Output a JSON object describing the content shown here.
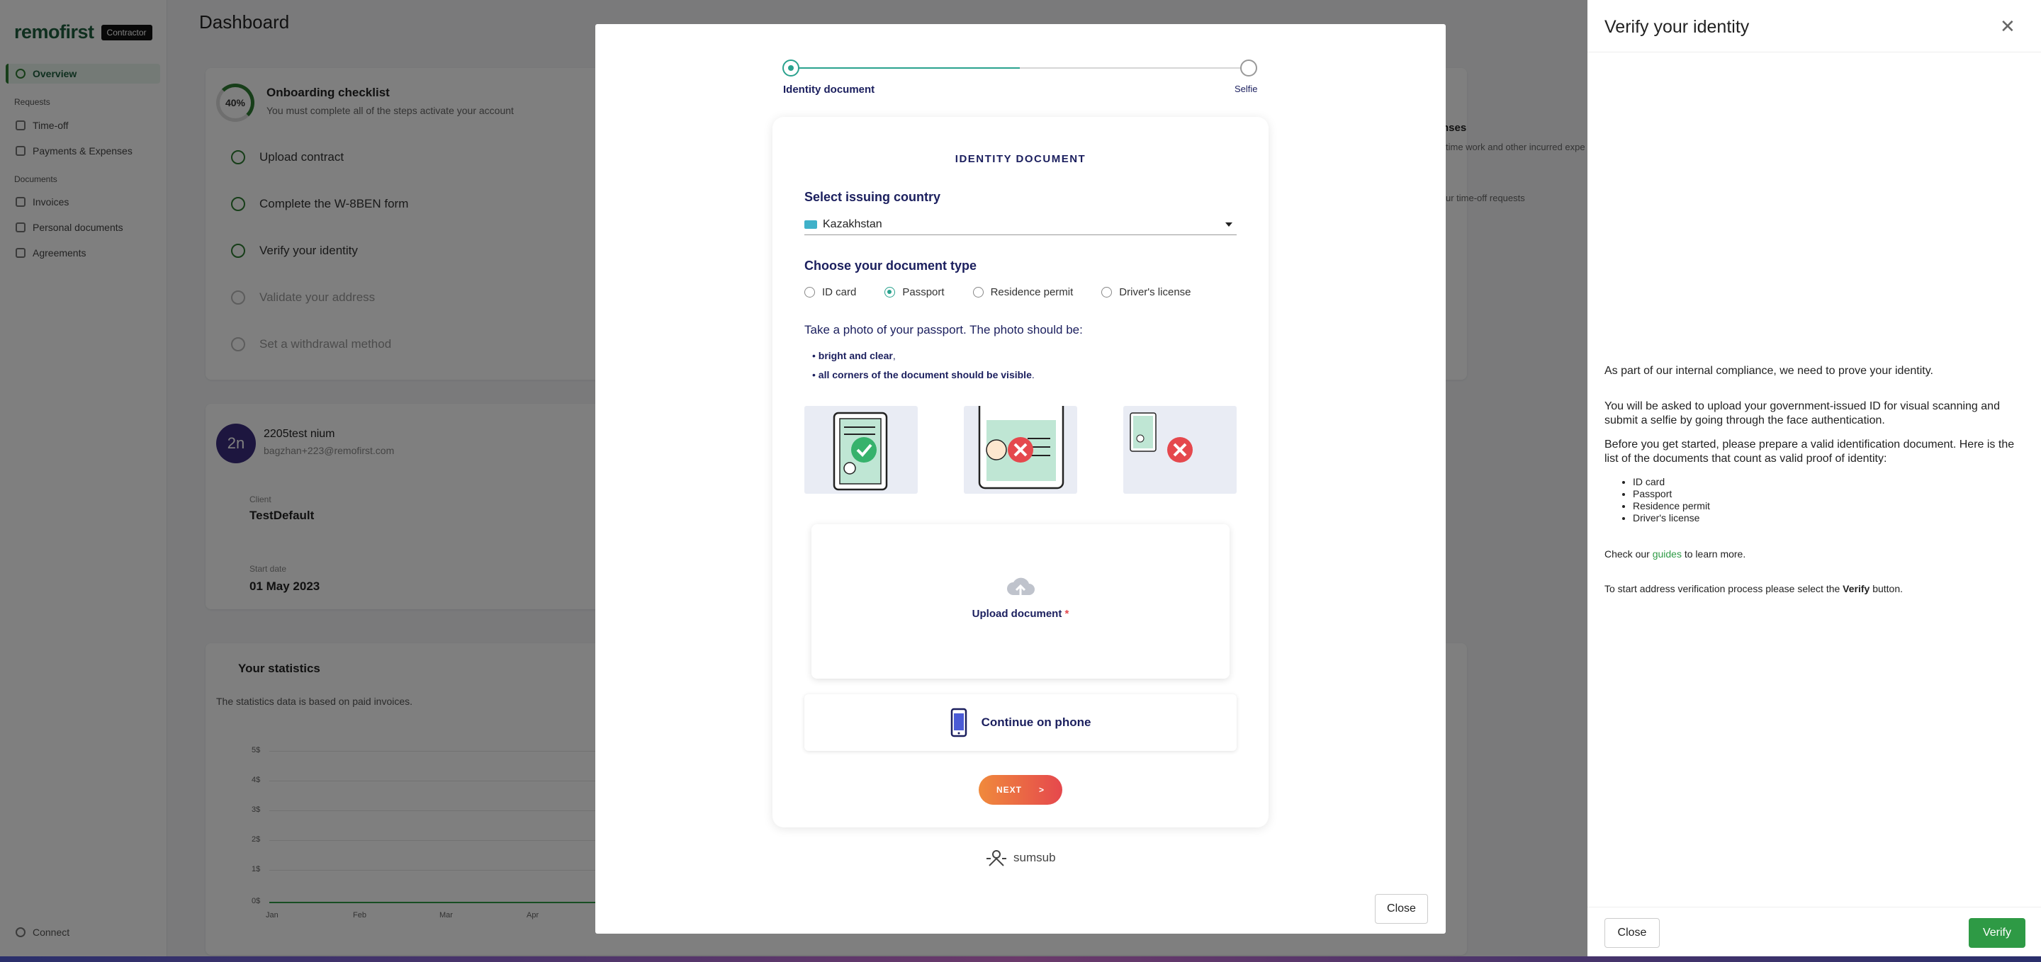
{
  "sidebar": {
    "logo": "remofirst",
    "badge": "Contractor",
    "items": [
      {
        "label": "Overview",
        "section": ""
      },
      {
        "label": "Time-off",
        "section": "Requests"
      },
      {
        "label": "Payments & Expenses",
        "section": ""
      },
      {
        "label": "Invoices",
        "section": "Documents"
      },
      {
        "label": "Personal documents",
        "section": ""
      },
      {
        "label": "Agreements",
        "section": ""
      }
    ],
    "sections": [
      "Requests",
      "Documents"
    ],
    "connect": "Connect"
  },
  "dashboard": {
    "title": "Dashboard",
    "onboarding": {
      "percent": "40%",
      "title": "Onboarding checklist",
      "subtitle": "You must complete all of the steps activate your account",
      "items": [
        "Upload contract",
        "Complete the W-8BEN form",
        "Verify your identity",
        "Validate your address",
        "Set a withdrawal method"
      ]
    },
    "user": {
      "initials": "2n",
      "name": "2205test nium",
      "email": "bagzhan+223@remofirst.com",
      "client_label": "Client",
      "client_value": "TestDefault",
      "start_label": "Start date",
      "start_value": "01 May 2023"
    },
    "stats": {
      "title": "Your statistics",
      "subtitle": "The statistics data is based on paid invoices.",
      "yticks": [
        "5$",
        "4$",
        "3$",
        "2$",
        "1$",
        "0$"
      ],
      "xticks": [
        "Jan",
        "Feb",
        "Mar",
        "Apr"
      ]
    },
    "right_card": {
      "title": "nses",
      "line1": "time work and other incurred expe",
      "line2": "ur time-off requests"
    }
  },
  "modal": {
    "steps": [
      "Identity document",
      "Selfie"
    ],
    "heading": "IDENTITY DOCUMENT",
    "country_label": "Select issuing country",
    "country_value": "Kazakhstan",
    "doc_type_label": "Choose your document type",
    "doc_types": [
      "ID card",
      "Passport",
      "Residence permit",
      "Driver's license"
    ],
    "selected_doc_type": "Passport",
    "photo_instruction": "Take a photo of your passport. The photo should be:",
    "bullets": [
      {
        "bold": "bright and clear",
        "rest": ","
      },
      {
        "bold": "all corners of the document should be visible",
        "rest": "."
      }
    ],
    "upload_label": "Upload document",
    "upload_required": "*",
    "phone_label": "Continue on phone",
    "next_label": "NEXT",
    "next_arrow": ">",
    "brand": "sumsub",
    "close": "Close"
  },
  "drawer": {
    "title": "Verify your identity",
    "p1": "As part of our internal compliance, we need to prove your identity.",
    "p2": "You will be asked to upload your government-issued ID for visual scanning and submit a selfie by going through the face authentication.",
    "p3": "Before you get started, please prepare a valid identification document. Here is the list of the documents that count as valid proof of identity:",
    "list": [
      "ID card",
      "Passport",
      "Residence permit",
      "Driver's license"
    ],
    "check_prefix": "Check our ",
    "check_link": "guides",
    "check_suffix": " to learn more.",
    "start_prefix": "To start address verification process please select the ",
    "start_bold": "Verify",
    "start_suffix": " button.",
    "close": "Close",
    "verify": "Verify"
  },
  "colors": {
    "brand_green": "#2e9a45",
    "navy": "#1b1f5e",
    "teal": "#2aa28e",
    "danger": "#e5484d",
    "orange": "#f08a3c"
  }
}
